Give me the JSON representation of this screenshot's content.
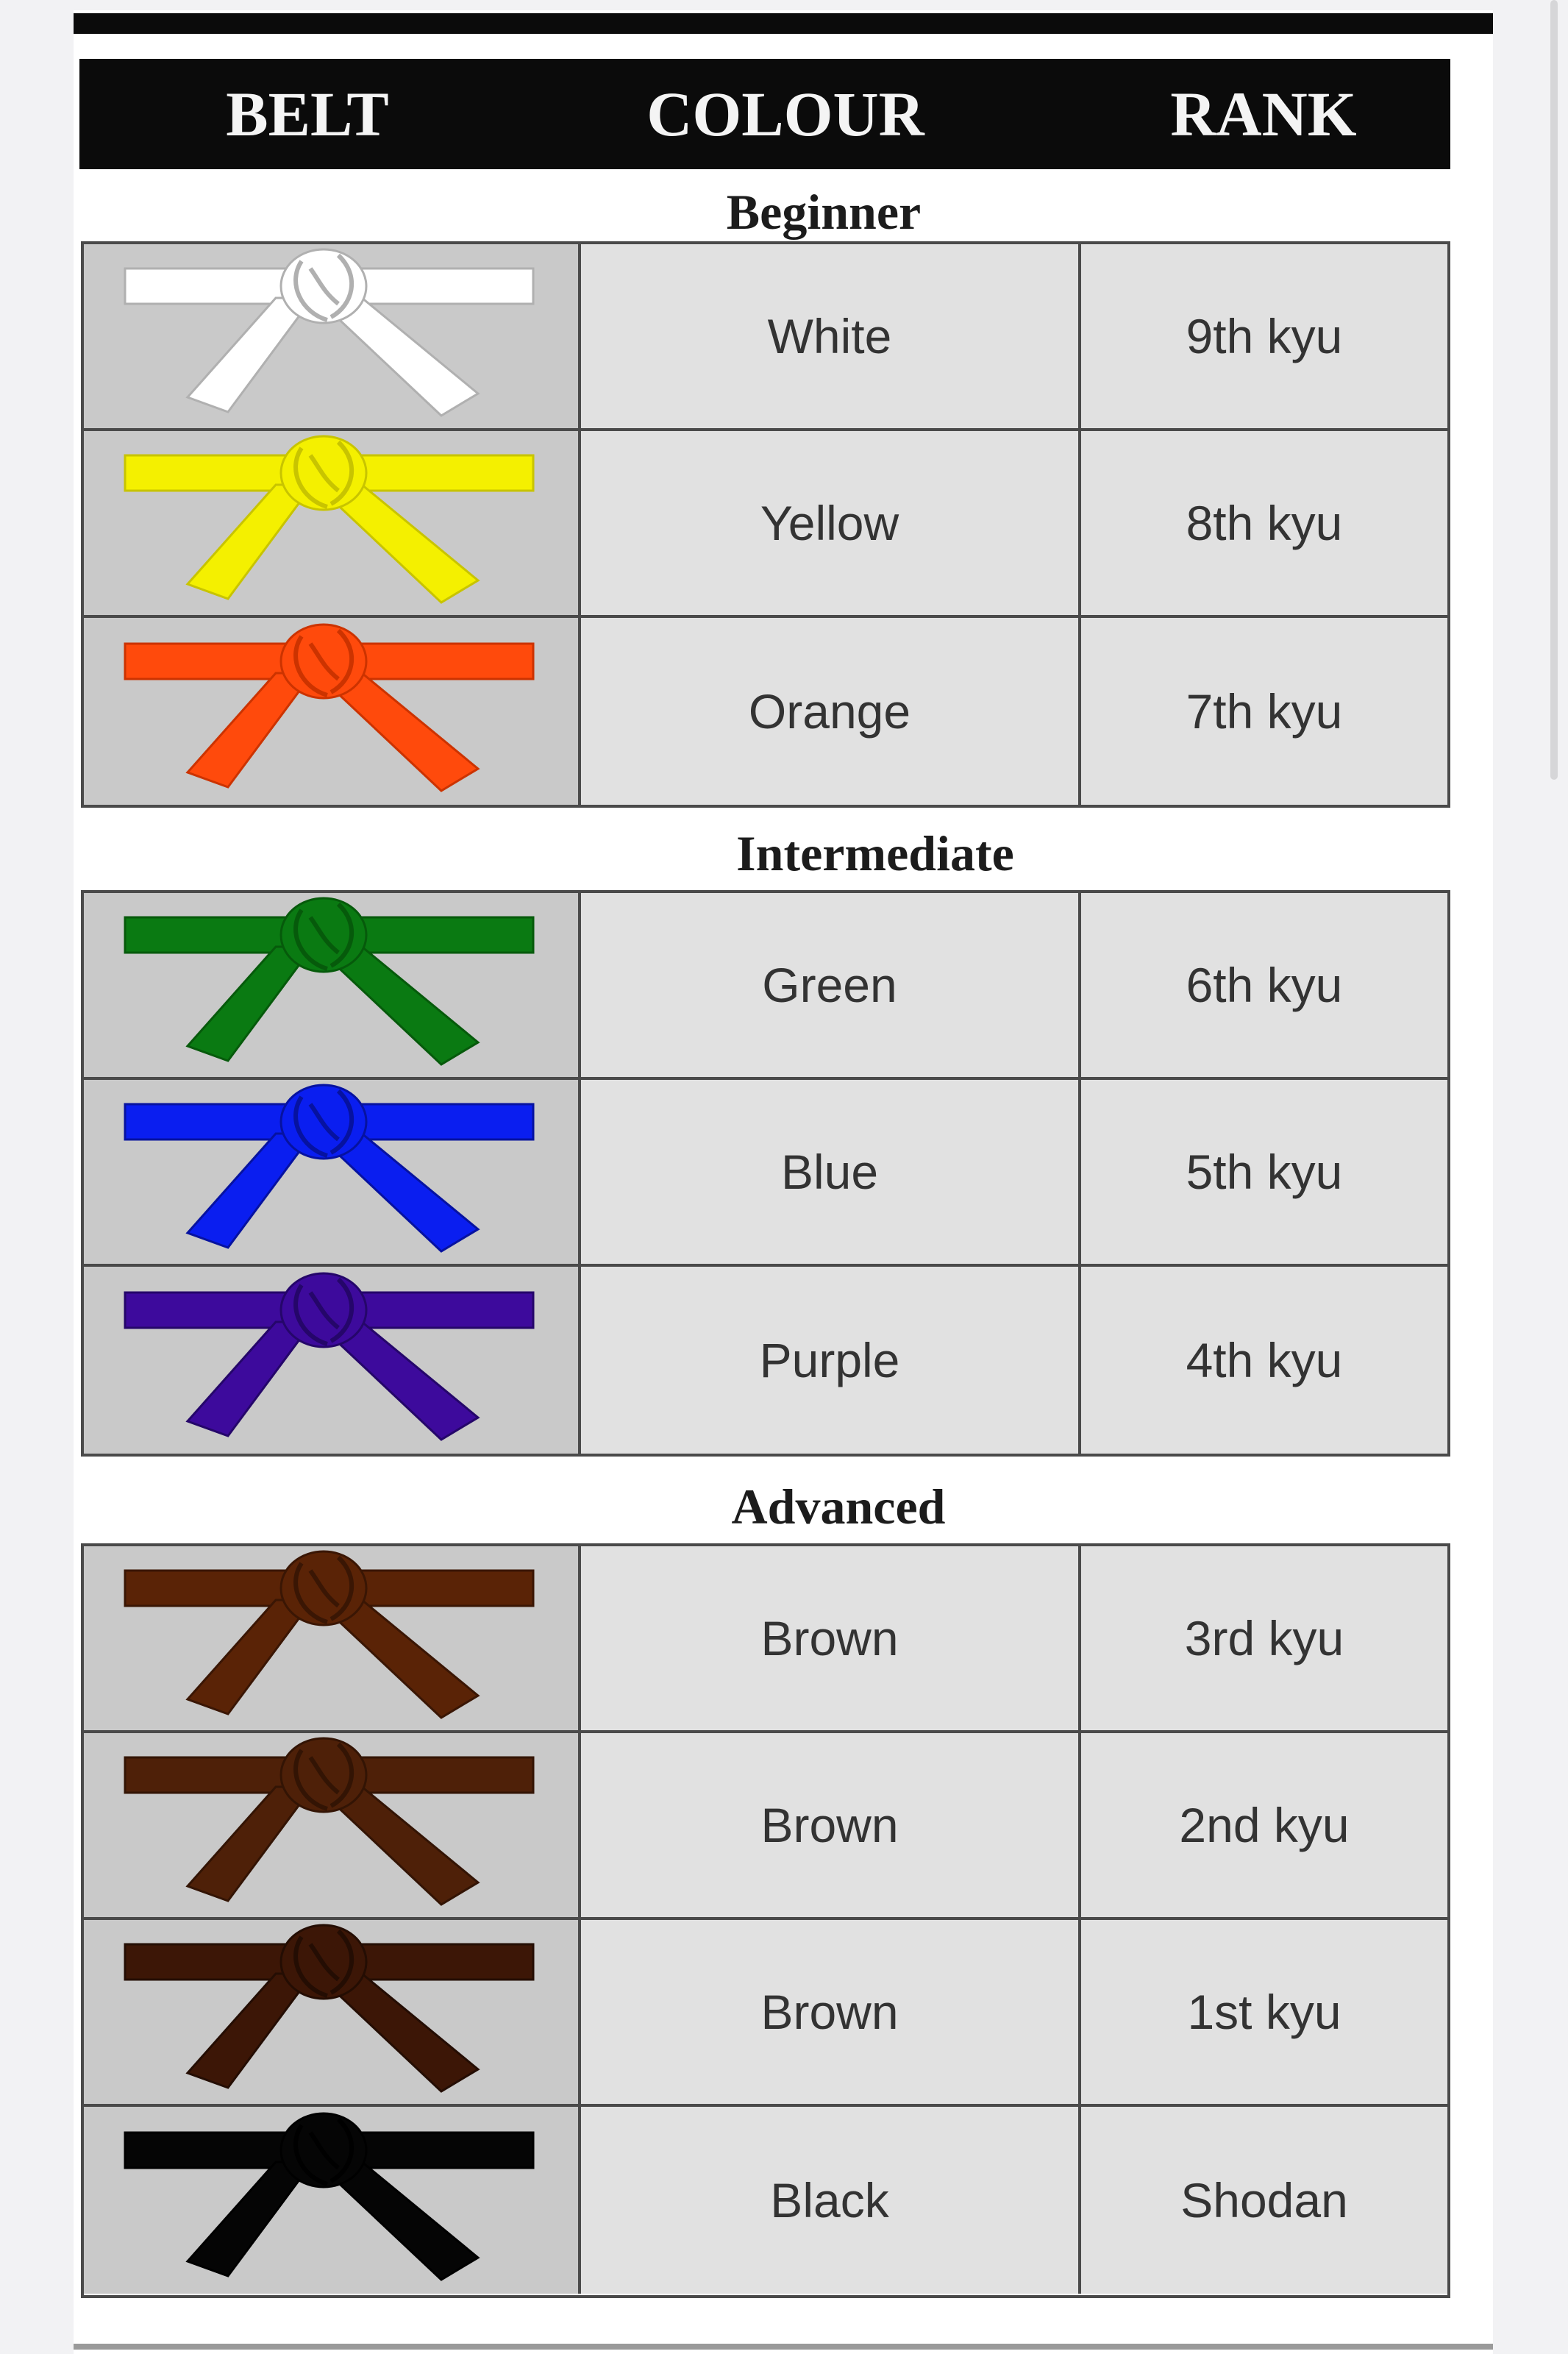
{
  "headers": {
    "belt": "BELT",
    "colour": "COLOUR",
    "rank": "RANK"
  },
  "sections": [
    {
      "title": "Beginner",
      "rows": [
        {
          "colour": "White",
          "rank": "9th kyu",
          "color_hex": "#ffffff",
          "stroke": "#b0b0b0",
          "icon": "white-belt-icon"
        },
        {
          "colour": "Yellow",
          "rank": "8th kyu",
          "color_hex": "#f4f000",
          "stroke": "#c8c400",
          "icon": "yellow-belt-icon"
        },
        {
          "colour": "Orange",
          "rank": "7th kyu",
          "color_hex": "#ff4a0c",
          "stroke": "#cc3300",
          "icon": "orange-belt-icon"
        }
      ]
    },
    {
      "title": "Intermediate",
      "rows": [
        {
          "colour": "Green",
          "rank": "6th kyu",
          "color_hex": "#0a7a12",
          "stroke": "#065a0b",
          "icon": "green-belt-icon"
        },
        {
          "colour": "Blue",
          "rank": "5th kyu",
          "color_hex": "#0a1ef0",
          "stroke": "#0612a0",
          "icon": "blue-belt-icon"
        },
        {
          "colour": "Purple",
          "rank": "4th kyu",
          "color_hex": "#3d0a9c",
          "stroke": "#25066a",
          "icon": "purple-belt-icon"
        }
      ]
    },
    {
      "title": "Advanced",
      "rows": [
        {
          "colour": "Brown",
          "rank": "3rd kyu",
          "color_hex": "#5a2306",
          "stroke": "#3a1604",
          "icon": "brown-belt-icon"
        },
        {
          "colour": "Brown",
          "rank": "2nd kyu",
          "color_hex": "#4e2008",
          "stroke": "#331404",
          "icon": "brown-belt-icon"
        },
        {
          "colour": "Brown",
          "rank": "1st kyu",
          "color_hex": "#3c1606",
          "stroke": "#240d03",
          "icon": "brown-belt-icon"
        },
        {
          "colour": "Black",
          "rank": "Shodan",
          "color_hex": "#050505",
          "stroke": "#000000",
          "icon": "black-belt-icon"
        }
      ]
    }
  ]
}
